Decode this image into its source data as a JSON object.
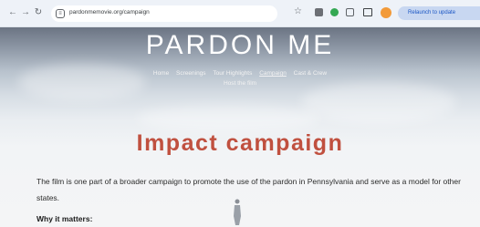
{
  "browser": {
    "url": "pardonmemovie.org/campaign",
    "relaunch_label": "Relaunch to update"
  },
  "site": {
    "title": "PARDON ME",
    "nav_items": [
      "Home",
      "Screenings",
      "Tour Highlights",
      "Campaign",
      "Cast & Crew"
    ],
    "nav_second_row": "Host the film",
    "active_nav": "Campaign"
  },
  "content": {
    "heading": "Impact campaign",
    "paragraph": "The film is one part of a broader campaign to promote the use of the pardon in Pennsylvania and serve as a model for other states.",
    "subheading": "Why it matters:"
  },
  "colors": {
    "heading": "#c0503f",
    "chrome_bg": "#eef2f8",
    "relaunch_bg": "#c8d7f1"
  }
}
